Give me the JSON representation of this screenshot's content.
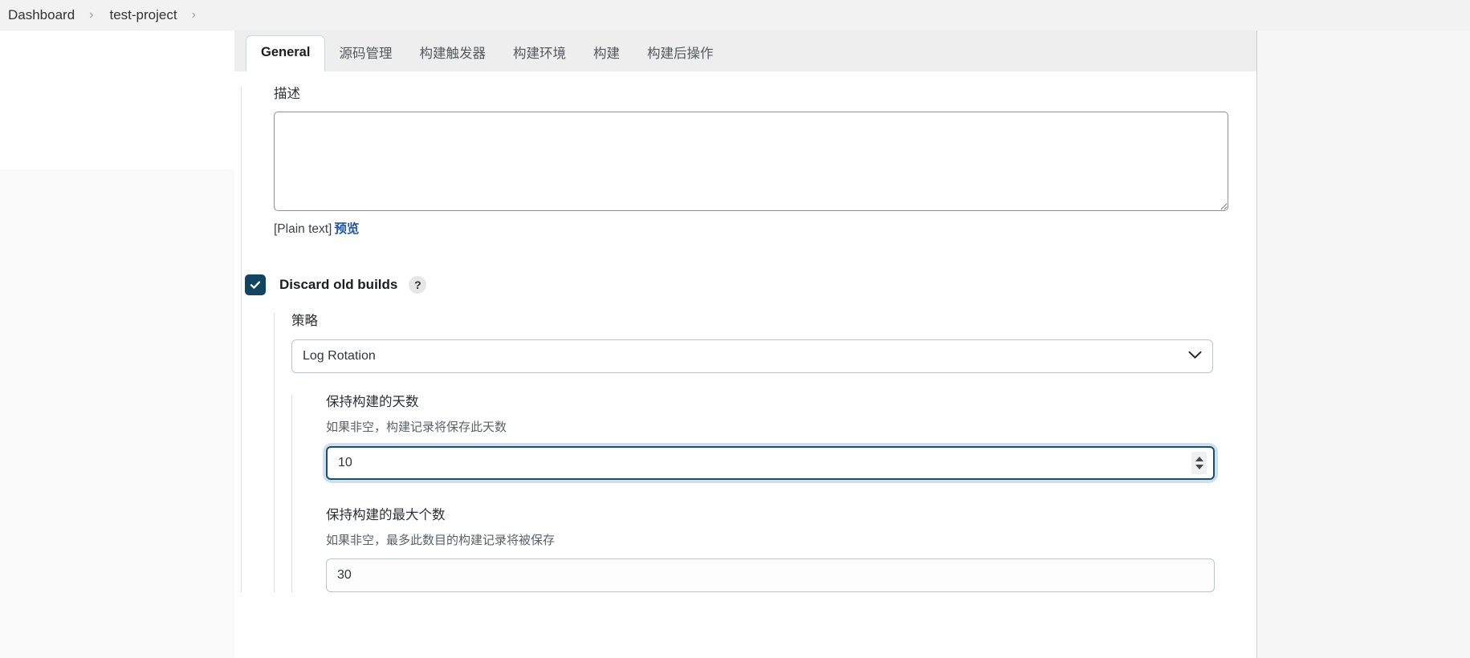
{
  "breadcrumb": {
    "items": [
      {
        "label": "Dashboard"
      },
      {
        "label": "test-project"
      }
    ],
    "separator": "›"
  },
  "tabs": [
    {
      "label": "General",
      "active": true
    },
    {
      "label": "源码管理",
      "active": false
    },
    {
      "label": "构建触发器",
      "active": false
    },
    {
      "label": "构建环境",
      "active": false
    },
    {
      "label": "构建",
      "active": false
    },
    {
      "label": "构建后操作",
      "active": false
    }
  ],
  "form": {
    "description": {
      "label": "描述",
      "value": "",
      "placeholder": "",
      "markup_note": "[Plain text]",
      "preview_link": "预览"
    },
    "discard_old_builds": {
      "label": "Discard old builds",
      "checked": true,
      "help_glyph": "?",
      "strategy": {
        "label": "策略",
        "selected": "Log Rotation",
        "options": [
          "Log Rotation"
        ]
      },
      "days_to_keep": {
        "label": "保持构建的天数",
        "description": "如果非空，构建记录将保存此天数",
        "value": "10",
        "focused": true
      },
      "max_builds_to_keep": {
        "label": "保持构建的最大个数",
        "description": "如果非空，最多此数目的构建记录将被保存",
        "value": "30",
        "focused": false
      }
    }
  },
  "colors": {
    "accent_checkbox": "#11455f",
    "link": "#1f55a5",
    "focus_ring": "#cfe0ec",
    "panel_bg": "#ffffff",
    "page_bg": "#f7f7f8",
    "tabstrip_bg": "#eeeeef"
  }
}
